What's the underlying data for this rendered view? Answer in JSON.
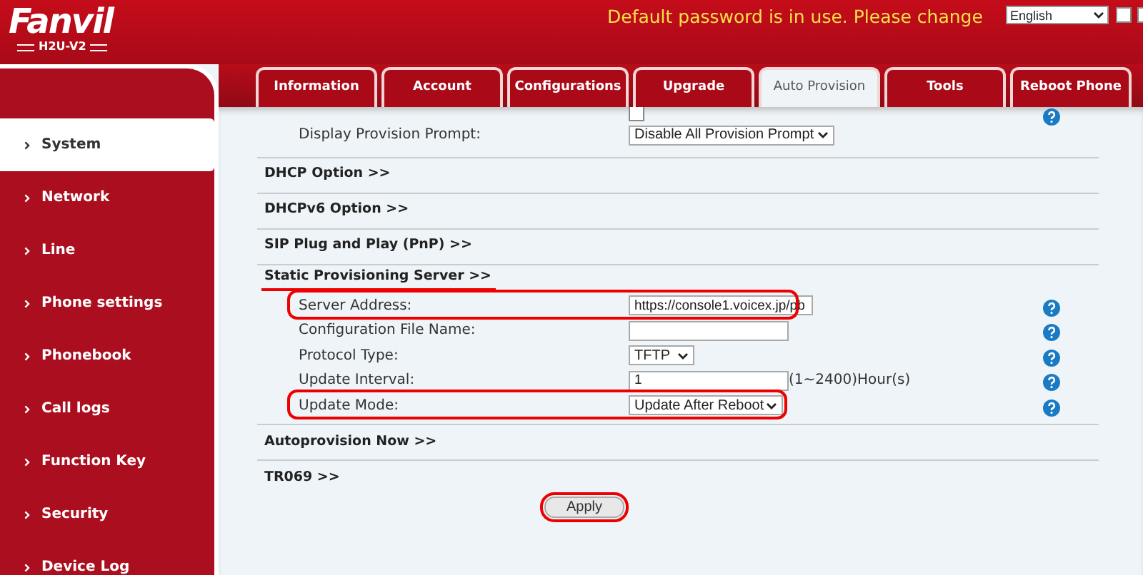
{
  "logo": {
    "brand": "Fanvil",
    "model": "H2U-V2"
  },
  "header": {
    "warning": "Default password is in use. Please change",
    "language": "English",
    "checkboxes": [
      {
        "checked": false
      },
      {
        "checked": false
      }
    ]
  },
  "tabs": [
    {
      "label": "Information",
      "selected": false
    },
    {
      "label": "Account",
      "selected": false
    },
    {
      "label": "Configurations",
      "selected": false
    },
    {
      "label": "Upgrade",
      "selected": false
    },
    {
      "label": "Auto Provision",
      "selected": true
    },
    {
      "label": "Tools",
      "selected": false
    },
    {
      "label": "Reboot Phone",
      "selected": false
    }
  ],
  "sidebar": {
    "items": [
      {
        "label": "System",
        "selected": true
      },
      {
        "label": "Network",
        "selected": false
      },
      {
        "label": "Line",
        "selected": false
      },
      {
        "label": "Phone settings",
        "selected": false
      },
      {
        "label": "Phonebook",
        "selected": false
      },
      {
        "label": "Call logs",
        "selected": false
      },
      {
        "label": "Function Key",
        "selected": false
      },
      {
        "label": "Security",
        "selected": false
      },
      {
        "label": "Device Log",
        "selected": false
      }
    ]
  },
  "top_rows": [
    {
      "kind": "checkbox",
      "checked": false,
      "help": true
    },
    {
      "kind": "select",
      "label": "Display Provision Prompt:",
      "value": "Disable All Provision Prompt",
      "help": false
    }
  ],
  "sections": [
    {
      "title": "DHCP Option >>",
      "underlined": false
    },
    {
      "title": "DHCPv6 Option >>",
      "underlined": false
    },
    {
      "title": "SIP Plug and Play (PnP) >>",
      "underlined": false
    },
    {
      "title": "Static Provisioning Server >>",
      "underlined": true,
      "rows": [
        {
          "kind": "text",
          "label": "Server Address:",
          "value": "https://console1.voicex.jp/pb",
          "highlighted": true
        },
        {
          "kind": "text",
          "label": "Configuration File Name:",
          "highlighted": false
        },
        {
          "kind": "select-small",
          "label": "Protocol Type:",
          "value": "TFTP",
          "highlighted": false
        },
        {
          "kind": "text",
          "label": "Update Interval:",
          "value": "1",
          "suffix": "(1~2400)Hour(s)",
          "highlighted": false
        },
        {
          "kind": "select",
          "label": "Update Mode:",
          "value": "Update After Reboot",
          "highlighted": true
        }
      ]
    },
    {
      "title": "Autoprovision Now >>",
      "underlined": false
    },
    {
      "title": "TR069 >>",
      "underlined": false
    }
  ],
  "apply_button": {
    "label": "Apply",
    "highlighted": true
  }
}
